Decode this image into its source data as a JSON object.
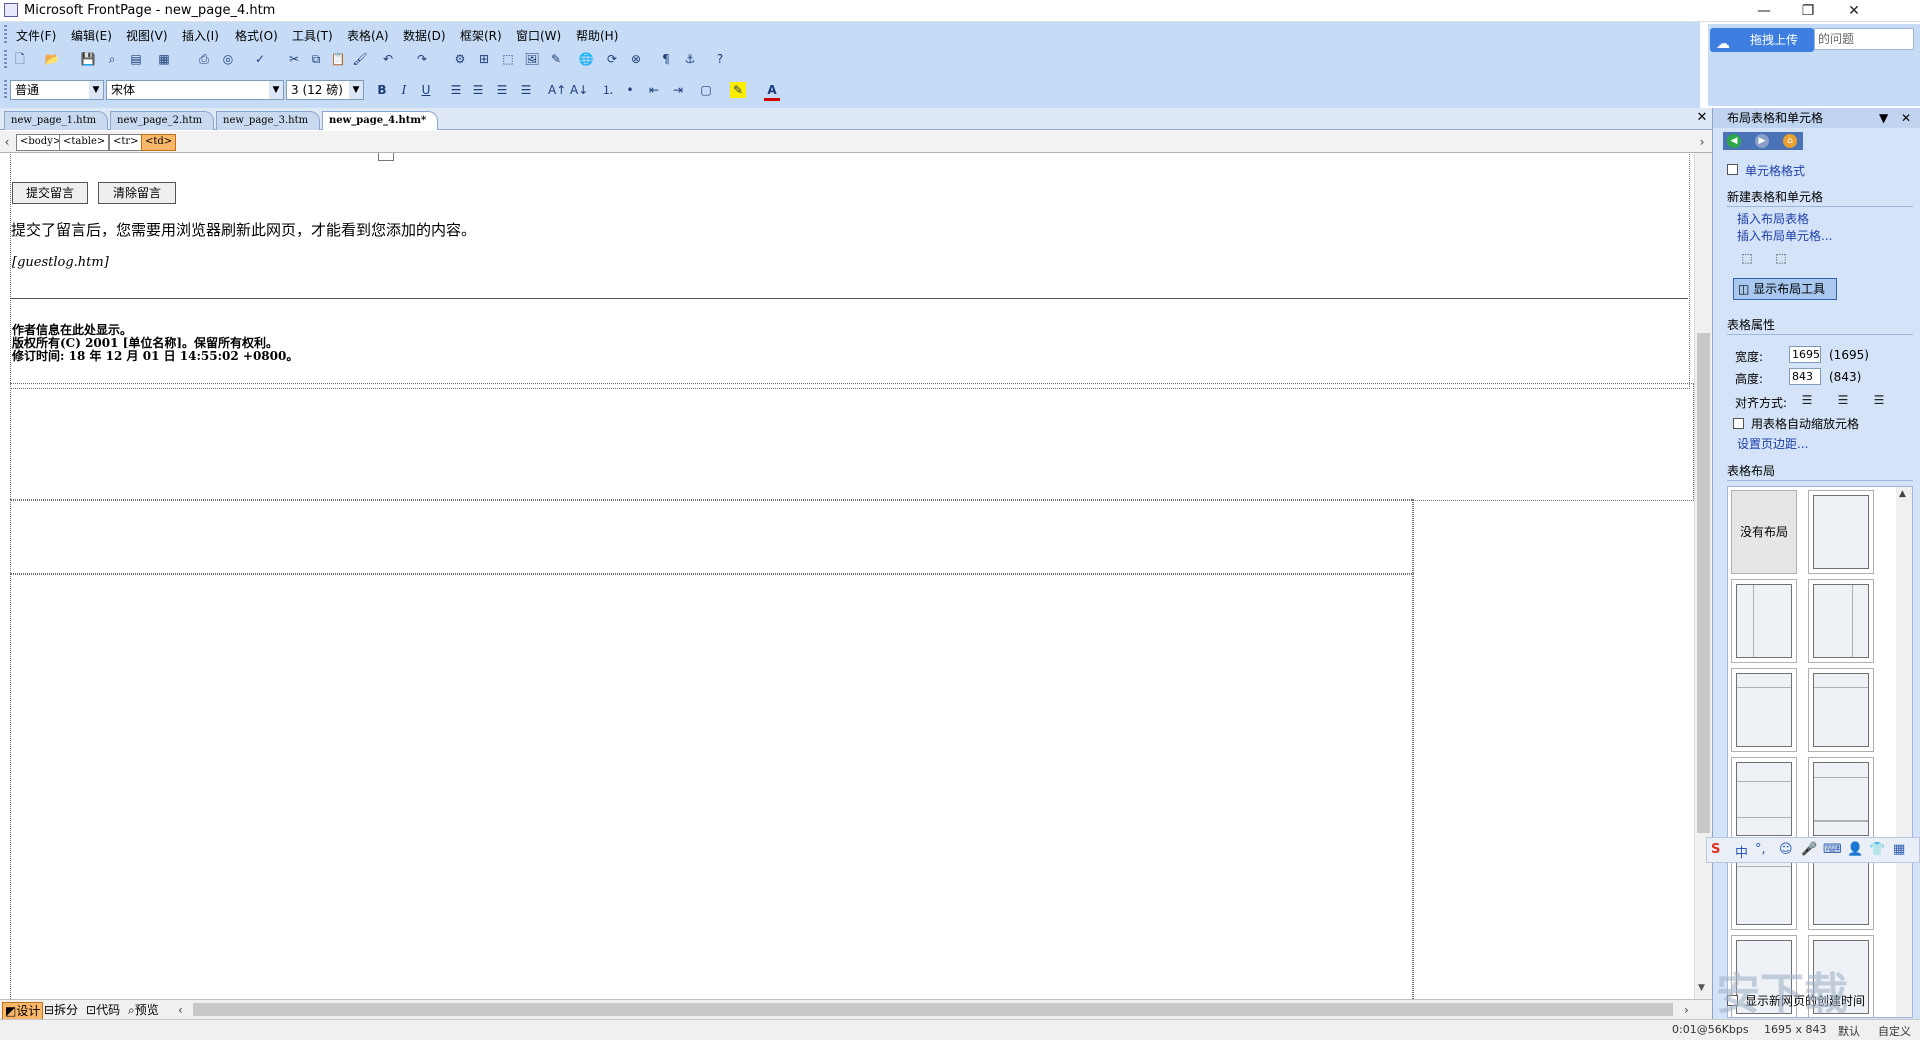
{
  "window": {
    "title": "Microsoft FrontPage - new_page_4.htm",
    "min_glyph": "—",
    "restore_glyph": "❐",
    "close_glyph": "✕"
  },
  "menu": [
    "文件(F)",
    "编辑(E)",
    "视图(V)",
    "插入(I)",
    "格式(O)",
    "工具(T)",
    "表格(A)",
    "数据(D)",
    "框架(R)",
    "窗口(W)",
    "帮助(H)"
  ],
  "toolbar": {
    "style_value": "普通",
    "font_value": "宋体",
    "size_value": "3 (12 磅)",
    "bold": "B",
    "italic": "I",
    "underline": "U"
  },
  "cloud": {
    "upload_label": "拖拽上传",
    "search_placeholder": "的问题"
  },
  "tabs": [
    {
      "label": "new_page_1.htm",
      "active": false
    },
    {
      "label": "new_page_2.htm",
      "active": false
    },
    {
      "label": "new_page_3.htm",
      "active": false
    },
    {
      "label": "new_page_4.htm*",
      "active": true
    }
  ],
  "tags": [
    "<body>",
    "<table>",
    "<tr>",
    "<td>"
  ],
  "page": {
    "submit_button": "提交留言",
    "clear_button": "清除留言",
    "refresh_note": "提交了留言后，您需要用浏览器刷新此网页，才能看到您添加的内容。",
    "include_file": "[guestlog.htm]",
    "author_line": "作者信息在此处显示。",
    "copyright_line": "版权所有(C) 2001 [单位名称]。保留所有权利。",
    "revised_line": "修订时间: 18 年 12 月 01 日 14:55:02 +0800。"
  },
  "views": [
    "设计",
    "拆分",
    "代码",
    "预览"
  ],
  "status": {
    "speed": "0:01@56Kbps",
    "dims": "1695 x 843",
    "default": "默认",
    "custom": "自定义"
  },
  "taskpane": {
    "title": "布局表格和单元格",
    "cell_format": "单元格格式",
    "new_section": "新建表格和单元格",
    "insert_layout_table": "插入布局表格",
    "insert_layout_cell": "插入布局单元格...",
    "show_layout_tool": "显示布局工具",
    "table_props": "表格属性",
    "width_label": "宽度:",
    "width_value": "1695",
    "width_actual": "(1695)",
    "height_label": "高度:",
    "height_value": "843",
    "height_actual": "(843)",
    "align_label": "对齐方式:",
    "autoscale_label": "用表格自动缩放元格",
    "set_margins": "设置页边距...",
    "table_layout": "表格布局",
    "no_layout": "没有布局",
    "show_created_time": "显示新网页的创建时间"
  },
  "ime": {
    "lang": "中",
    "punct": "°,"
  },
  "watermark": "安下载"
}
